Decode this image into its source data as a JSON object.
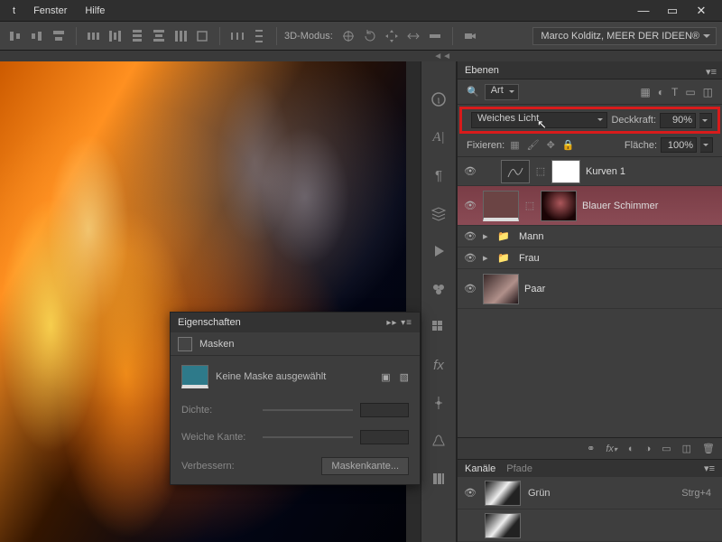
{
  "menu": {
    "items": [
      "t",
      "Fenster",
      "Hilfe"
    ]
  },
  "window_controls": {
    "min": "—",
    "max": "▭",
    "close": "✕"
  },
  "toolbar": {
    "mode_label": "3D-Modus:",
    "options_dropdown": "Marco Kolditz, MEER DER IDEEN®"
  },
  "layers_panel": {
    "tab": "Ebenen",
    "filter_label": "Art",
    "blend_mode": "Weiches Licht",
    "opacity_label": "Deckkraft:",
    "opacity_value": "90%",
    "lock_label": "Fixieren:",
    "fill_label": "Fläche:",
    "fill_value": "100%",
    "layers": [
      {
        "name": "Kurven 1"
      },
      {
        "name": "Blauer Schimmer"
      },
      {
        "name": "Mann"
      },
      {
        "name": "Frau"
      },
      {
        "name": "Paar"
      }
    ],
    "footer_icons": [
      "⟲",
      "fx▾",
      "◐",
      "◇",
      "▭",
      "🗑"
    ]
  },
  "channels_panel": {
    "tab1": "Kanäle",
    "tab2": "Pfade",
    "rows": [
      {
        "name": "Grün",
        "shortcut": "Strg+4"
      }
    ]
  },
  "properties_panel": {
    "tab": "Eigenschaften",
    "subtab": "Masken",
    "no_mask": "Keine Maske ausgewählt",
    "density": "Dichte:",
    "feather": "Weiche Kante:",
    "refine": "Verbessern:",
    "mask_edge": "Maskenkante..."
  }
}
